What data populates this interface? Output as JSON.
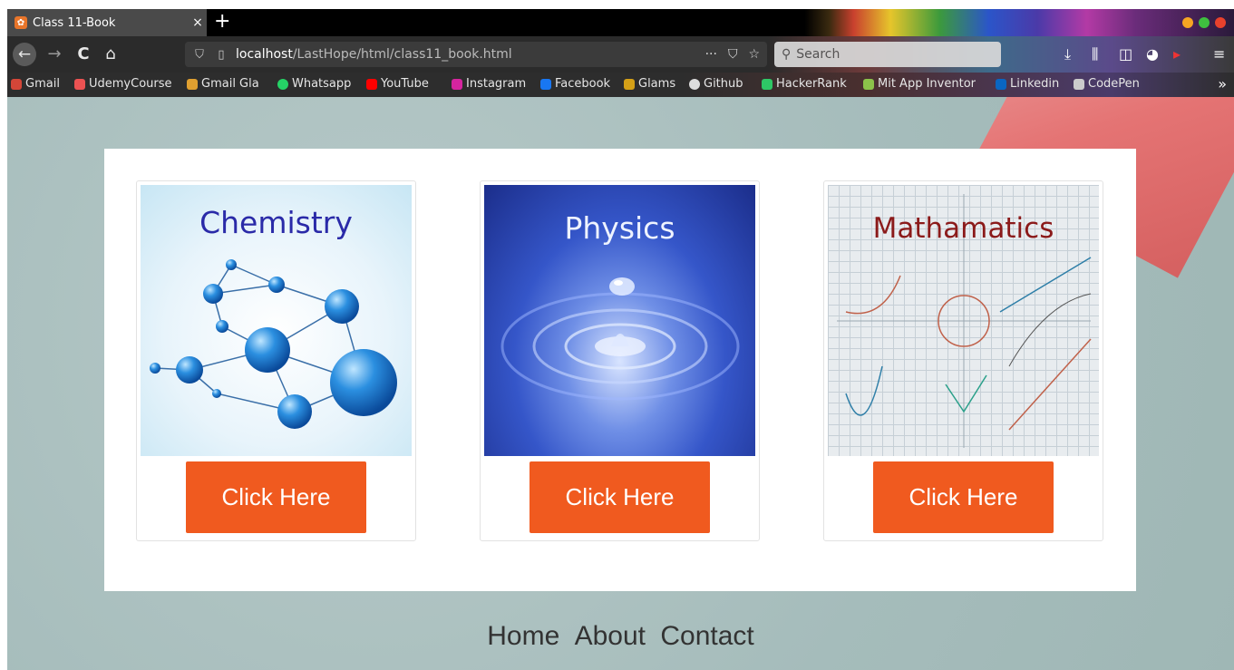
{
  "browser": {
    "tab_title": "Class 11-Book",
    "tab_close": "×",
    "new_tab": "+",
    "url_host": "localhost",
    "url_path": "/LastHope/html/class11_book.html",
    "url_menu": "···",
    "search_placeholder": "Search",
    "nav": {
      "back": "←",
      "forward": "→",
      "reload": "C",
      "home": "⌂"
    },
    "bookmarks": [
      {
        "label": "Gmail",
        "color": "#d44638"
      },
      {
        "label": "UdemyCourse",
        "color": "#ec5252"
      },
      {
        "label": "Gmail Gla",
        "color": "#e0a030"
      },
      {
        "label": "Whatsapp",
        "color": "#25d366"
      },
      {
        "label": "YouTube",
        "color": "#ff0000"
      },
      {
        "label": "Instagram",
        "color": "#d6249f"
      },
      {
        "label": "Facebook",
        "color": "#1877f2"
      },
      {
        "label": "Glams",
        "color": "#d4a017"
      },
      {
        "label": "Github",
        "color": "#dddddd"
      },
      {
        "label": "HackerRank",
        "color": "#2ec866"
      },
      {
        "label": "Mit App Inventor",
        "color": "#8bc34a"
      },
      {
        "label": "Linkedin",
        "color": "#0a66c2"
      },
      {
        "label": "CodePen",
        "color": "#cccccc"
      }
    ],
    "bookmarks_more": "»"
  },
  "cards": [
    {
      "title": "Chemistry",
      "button": "Click Here"
    },
    {
      "title": "Physics",
      "button": "Click Here"
    },
    {
      "title": "Mathamatics",
      "button": "Click Here"
    }
  ],
  "footer_nav": [
    "Home",
    "About",
    "Contact"
  ],
  "colors": {
    "button": "#f05a1f",
    "page_bg": "#a8bfbe"
  }
}
